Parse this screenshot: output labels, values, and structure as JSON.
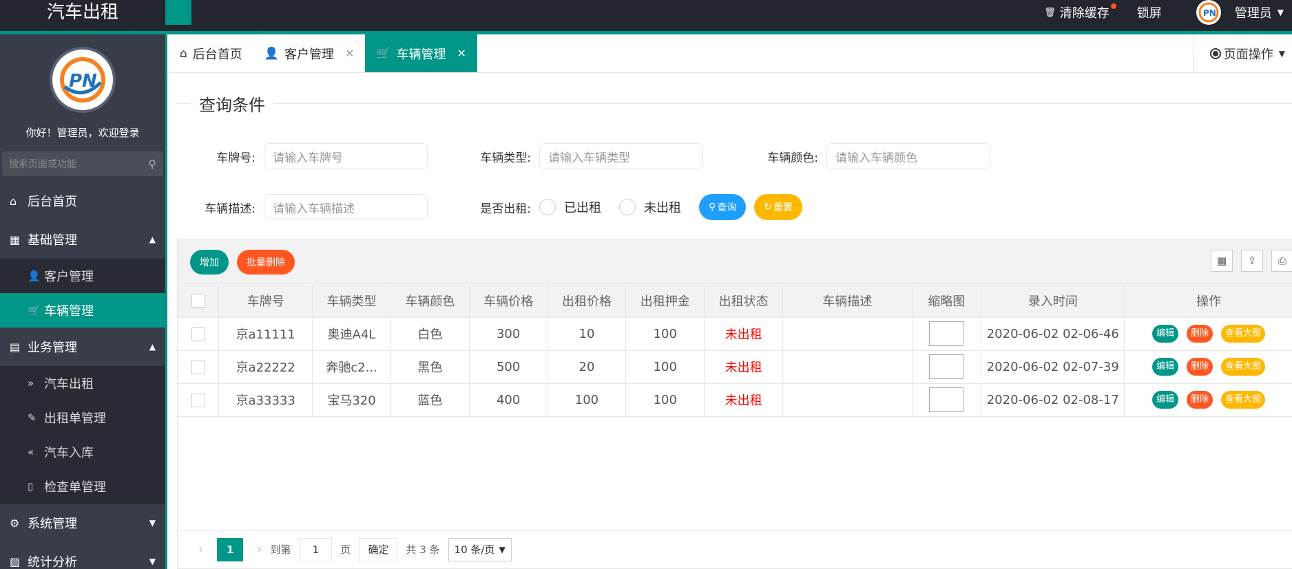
{
  "app": {
    "title": "汽车出租"
  },
  "topbar": {
    "clear_cache": "清除缓存",
    "lock": "锁屏",
    "admin": "管理员"
  },
  "sidebar": {
    "welcome": "你好！管理员，欢迎登录",
    "search_placeholder": "搜索页面或功能",
    "items": [
      {
        "label": "后台首页",
        "icon": "home-icon"
      },
      {
        "label": "基础管理",
        "icon": "grid-icon",
        "expanded": true,
        "children": [
          {
            "label": "客户管理",
            "icon": "user-icon"
          },
          {
            "label": "车辆管理",
            "icon": "cart-icon",
            "active": true
          }
        ]
      },
      {
        "label": "业务管理",
        "icon": "book-icon",
        "expanded": true,
        "children": [
          {
            "label": "汽车出租",
            "icon": "double-right-icon"
          },
          {
            "label": "出租单管理",
            "icon": "edit-doc-icon"
          },
          {
            "label": "汽车入库",
            "icon": "double-left-icon"
          },
          {
            "label": "检查单管理",
            "icon": "read-icon"
          }
        ]
      },
      {
        "label": "系统管理",
        "icon": "gear-icon"
      },
      {
        "label": "统计分析",
        "icon": "chart-icon"
      }
    ]
  },
  "tabs": [
    {
      "label": "后台首页",
      "icon": "home-icon",
      "closable": false
    },
    {
      "label": "客户管理",
      "icon": "user-icon",
      "closable": true
    },
    {
      "label": "车辆管理",
      "icon": "cart-icon",
      "closable": true,
      "active": true
    }
  ],
  "page_ops": "页面操作",
  "query": {
    "legend": "查询条件",
    "plate_label": "车牌号:",
    "plate_placeholder": "请输入车牌号",
    "type_label": "车辆类型:",
    "type_placeholder": "请输入车辆类型",
    "color_label": "车辆颜色:",
    "color_placeholder": "请输入车辆颜色",
    "desc_label": "车辆描述:",
    "desc_placeholder": "请输入车辆描述",
    "rented_label": "是否出租:",
    "rented_yes": "已出租",
    "rented_no": "未出租",
    "search_btn": "查询",
    "reset_btn": "重置"
  },
  "toolbar": {
    "add": "增加",
    "batch_delete": "批量删除"
  },
  "table": {
    "headers": [
      "车牌号",
      "车辆类型",
      "车辆颜色",
      "车辆价格",
      "出租价格",
      "出租押金",
      "出租状态",
      "车辆描述",
      "缩略图",
      "录入时间",
      "操作"
    ],
    "rows": [
      {
        "plate": "京a11111",
        "type": "奥迪A4L",
        "color": "白色",
        "price": "300",
        "rent": "10",
        "deposit": "100",
        "status": "未出租",
        "desc": "",
        "time": "2020-06-02 02-06-46"
      },
      {
        "plate": "京a22222",
        "type": "奔驰c2...",
        "color": "黑色",
        "price": "500",
        "rent": "20",
        "deposit": "100",
        "status": "未出租",
        "desc": "",
        "time": "2020-06-02 02-07-39"
      },
      {
        "plate": "京a33333",
        "type": "宝马320",
        "color": "蓝色",
        "price": "400",
        "rent": "100",
        "deposit": "100",
        "status": "未出租",
        "desc": "",
        "time": "2020-06-02 02-08-17"
      }
    ],
    "op_edit": "编辑",
    "op_delete": "删除",
    "op_view": "查看大图"
  },
  "pager": {
    "current": "1",
    "goto": "到第",
    "page_input": "1",
    "page_unit": "页",
    "confirm": "确定",
    "total": "共 3 条",
    "page_size": "10 条/页"
  },
  "colors": {
    "primary": "#009688",
    "blue": "#1e9fff",
    "yellow": "#ffb800",
    "orange": "#ff5722",
    "sidebar": "#393d49",
    "topbar": "#23262e"
  }
}
